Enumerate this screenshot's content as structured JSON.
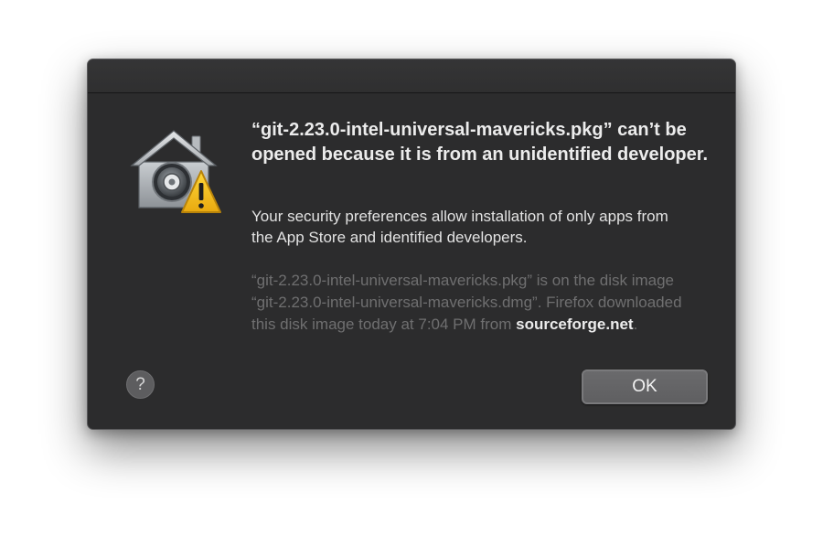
{
  "dialog": {
    "headline": "“git-2.23.0-intel-universal-mavericks.pkg” can’t be opened because it is from an unidentified developer.",
    "info": "Your security preferences allow installation of only apps from the App Store and identified developers.",
    "detail_prefix": "“git-2.23.0-intel-universal-mavericks.pkg” is on the disk image “git-2.23.0-intel-universal-mavericks.dmg”. Firefox downloaded this disk image today at 7:04 PM from ",
    "detail_source": "sourceforge.net",
    "detail_suffix": ".",
    "icon": "gatekeeper-warning-icon"
  },
  "buttons": {
    "help_label": "?",
    "ok_label": "OK"
  },
  "colors": {
    "dialog_background": "#2c2c2d",
    "warning_yellow": "#f2c21a"
  }
}
